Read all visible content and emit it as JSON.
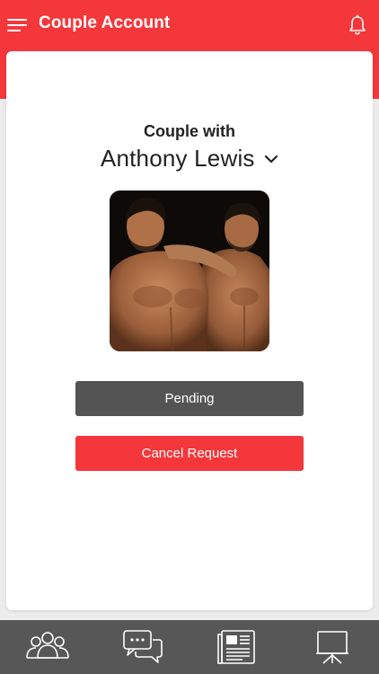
{
  "header": {
    "title": "Couple Account",
    "menu_icon": "hamburger-menu-icon",
    "bell_icon": "bell-icon"
  },
  "card": {
    "heading": "Couple with",
    "partner_name": "Anthony Lewis",
    "dropdown_icon": "chevron-down-icon"
  },
  "buttons": {
    "pending_label": "Pending",
    "cancel_label": "Cancel Request"
  },
  "tabbar": {
    "tabs": [
      {
        "icon": "people-group-icon"
      },
      {
        "icon": "chat-bubbles-icon"
      },
      {
        "icon": "newspaper-icon"
      },
      {
        "icon": "presentation-board-icon"
      }
    ]
  },
  "colors": {
    "brand_red": "#f4373b",
    "pending_gray": "#545454",
    "tabbar_gray": "#575757"
  }
}
